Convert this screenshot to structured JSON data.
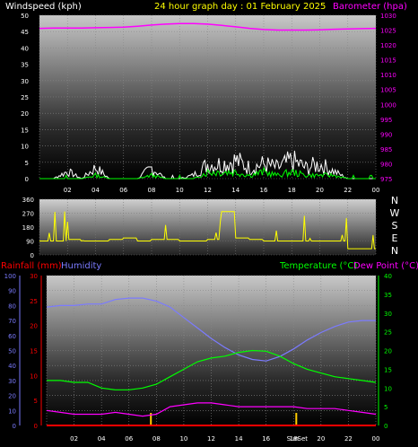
{
  "chart_data": [
    {
      "panel": "wind-pressure",
      "type": "line",
      "title": "24 hour graph day : 01 February 2025",
      "ylabel_left": "Windspeed (kph)",
      "ylabel_right": "Barometer (hpa)",
      "x_ticks": [
        "02",
        "04",
        "06",
        "08",
        "10",
        "12",
        "14",
        "16",
        "18",
        "20",
        "22",
        "00"
      ],
      "ylim_left": [
        0,
        50
      ],
      "left_ticks": [
        0,
        5,
        10,
        15,
        20,
        25,
        30,
        35,
        40,
        45,
        50
      ],
      "ylim_right": [
        975,
        1030
      ],
      "right_ticks": [
        975,
        980,
        985,
        990,
        995,
        1000,
        1005,
        1010,
        1015,
        1020,
        1025,
        1030
      ],
      "colors": {
        "barometer": "#ff00ff",
        "gust": "#ffffff",
        "avg": "#00ff00",
        "label_left": "#ffffff",
        "title": "#ffff00"
      },
      "x_hours": [
        0,
        1,
        2,
        3,
        4,
        5,
        6,
        7,
        8,
        9,
        10,
        11,
        12,
        13,
        14,
        15,
        16,
        17,
        18,
        19,
        20,
        21,
        22,
        23,
        24
      ],
      "series": [
        {
          "key": "barometer",
          "values": [
            1025.6,
            1025.7,
            1025.7,
            1025.7,
            1025.8,
            1025.9,
            1026.0,
            1026.3,
            1026.7,
            1027.0,
            1027.2,
            1027.2,
            1027.0,
            1026.6,
            1026.1,
            1025.6,
            1025.2,
            1025.0,
            1025.0,
            1025.0,
            1025.1,
            1025.3,
            1025.4,
            1025.5,
            1025.6
          ]
        },
        {
          "key": "gust",
          "values": [
            0,
            0,
            2,
            0,
            3,
            0,
            0,
            0,
            3,
            0,
            0,
            1,
            4,
            4,
            5,
            3,
            4,
            3,
            5,
            3,
            4,
            2,
            0,
            0,
            0
          ]
        },
        {
          "key": "avg",
          "values": [
            0,
            0,
            0,
            0,
            1,
            0,
            0,
            0,
            1,
            0,
            0,
            0,
            2,
            2,
            2,
            1,
            2,
            1,
            2,
            1,
            1,
            1,
            0,
            0,
            0
          ]
        }
      ]
    },
    {
      "panel": "wind-direction",
      "type": "line",
      "ylim": [
        0,
        360
      ],
      "y_ticks": [
        0,
        90,
        180,
        270,
        360
      ],
      "x_ticks": [],
      "direction_labels": [
        "N",
        "W",
        "S",
        "E",
        "N"
      ],
      "colors": {
        "direction": "#ffff00",
        "labels": "#ffffff"
      },
      "x_hours": [
        0,
        1,
        2,
        3,
        4,
        5,
        6,
        7,
        8,
        9,
        10,
        11,
        12,
        13,
        14,
        15,
        16,
        17,
        18,
        19,
        20,
        21,
        22,
        23,
        24
      ],
      "series": [
        {
          "key": "direction",
          "values": [
            90,
            90,
            100,
            90,
            90,
            100,
            110,
            90,
            100,
            100,
            90,
            90,
            100,
            280,
            110,
            100,
            90,
            90,
            90,
            90,
            90,
            90,
            40,
            40,
            40
          ]
        }
      ]
    },
    {
      "panel": "temp-rain-humidity",
      "type": "line",
      "label_rain": "Rainfall (mm)",
      "label_humidity": "Humidity",
      "label_temp": "Temperature (°C)",
      "label_dew": "Dew Point (°C)",
      "x_ticks": [
        "02",
        "04",
        "06",
        "08",
        "10",
        "12",
        "14",
        "16",
        "18",
        "20",
        "22",
        "00"
      ],
      "sun_labels": [
        "Sun",
        "Set"
      ],
      "humidity_ticks": [
        0,
        10,
        20,
        30,
        40,
        50,
        60,
        70,
        80,
        90,
        100
      ],
      "rain_ticks": [
        0,
        5,
        10,
        15,
        20,
        25,
        30
      ],
      "temp_ticks": [
        0,
        5,
        10,
        15,
        20,
        25,
        30,
        35,
        40
      ],
      "ylim_humidity": [
        0,
        100
      ],
      "ylim_rain": [
        0,
        30
      ],
      "ylim_temp": [
        0,
        40
      ],
      "colors": {
        "rain_label": "#ff0000",
        "humidity": "#7b7bff",
        "temperature": "#00ff00",
        "dew": "#ff00ff",
        "sun": "#ffcc00",
        "rain": "#ff0000"
      },
      "x_hours": [
        0,
        1,
        2,
        3,
        4,
        5,
        6,
        7,
        8,
        9,
        10,
        11,
        12,
        13,
        14,
        15,
        16,
        17,
        18,
        19,
        20,
        21,
        22,
        23,
        24
      ],
      "series": [
        {
          "key": "humidity",
          "values": [
            79,
            80,
            80,
            81,
            81,
            84,
            85,
            85,
            83,
            79,
            72,
            65,
            58,
            52,
            47,
            44,
            43,
            46,
            51,
            57,
            62,
            66,
            69,
            70,
            70
          ]
        },
        {
          "key": "temperature",
          "values": [
            12,
            12,
            11.5,
            11.5,
            10,
            9.5,
            9.5,
            10,
            11,
            13,
            15,
            17,
            18,
            18.5,
            19.5,
            20,
            19.8,
            18.5,
            16.5,
            15,
            14,
            13,
            12.5,
            12,
            11.5
          ]
        },
        {
          "key": "dew",
          "values": [
            4,
            3.5,
            3,
            3,
            3,
            3.5,
            3,
            2.5,
            3,
            5,
            5.5,
            6,
            6,
            5.5,
            5,
            5,
            5,
            5,
            5,
            4.5,
            4.5,
            4.5,
            4,
            3.5,
            3
          ]
        },
        {
          "key": "rain",
          "values": [
            0,
            0,
            0,
            0,
            0,
            0,
            0,
            0,
            0,
            0,
            0,
            0,
            0,
            0,
            0,
            0,
            0,
            0,
            0,
            0,
            0,
            0,
            0,
            0,
            0
          ]
        }
      ],
      "sun_events_hours": [
        7.6,
        18.2
      ]
    }
  ]
}
